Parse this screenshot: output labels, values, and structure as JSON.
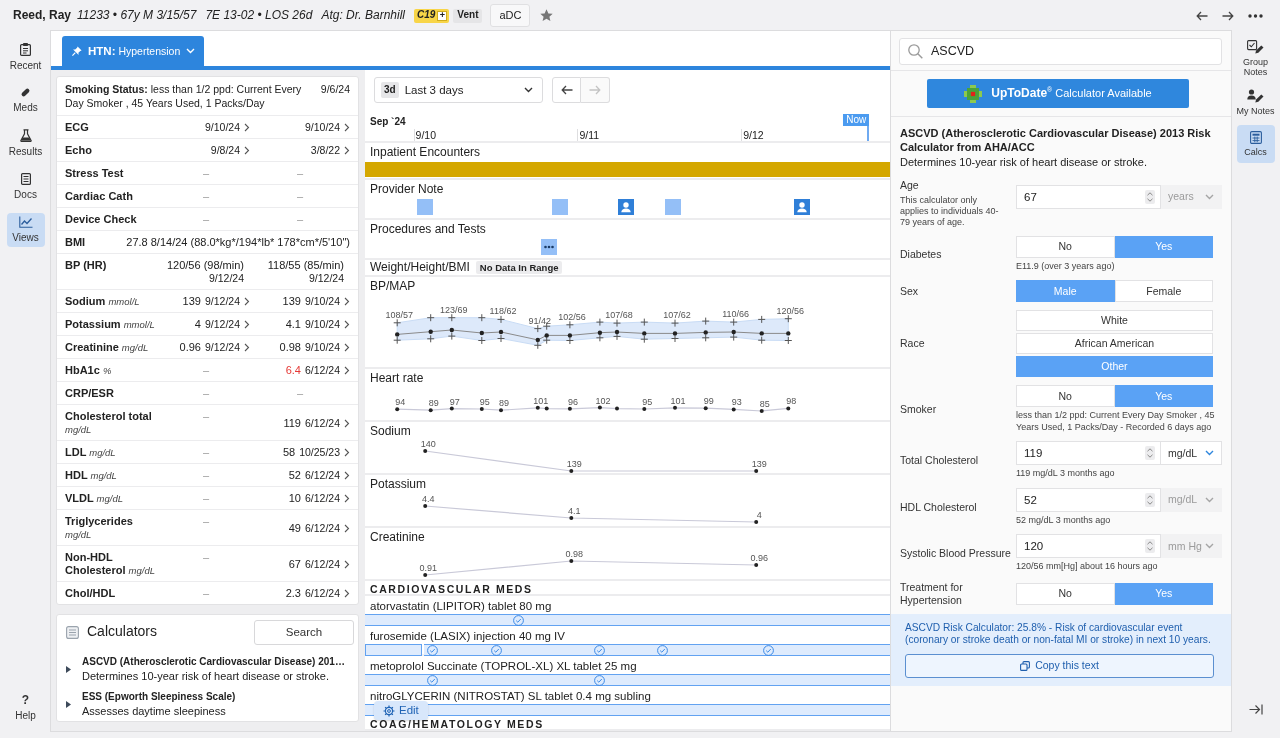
{
  "patient": {
    "name": "Reed, Ray",
    "details": [
      "11233 • 67y M 3/15/57",
      "7E 13-02 • LOS 26d",
      "Atg: Dr. Barnhill"
    ],
    "badges": [
      {
        "kind": "alert",
        "label": "C19",
        "extra": "+"
      },
      {
        "kind": "plain",
        "label": "Vent"
      }
    ],
    "button": "aDC"
  },
  "left_nav": {
    "items": [
      {
        "label": "Recent",
        "selected": false
      },
      {
        "label": "Meds",
        "selected": false
      },
      {
        "label": "Results",
        "selected": false
      },
      {
        "label": "Docs",
        "selected": false
      },
      {
        "label": "Views",
        "selected": true
      }
    ],
    "help": {
      "symbol": "?",
      "label": "Help"
    }
  },
  "problem_tab": {
    "label": "**HTN:** Hypertension",
    "selected": true
  },
  "summary_table": {
    "rows": [
      {
        "kind": "note",
        "text": "**Smoking Status:** less than 1/2 ppd: Current Every Day Smoker , 45 Years Used, 1 Packs/Day",
        "date": "9/6/24"
      },
      {
        "kind": "lab",
        "name": "ECG",
        "cells": [
          {
            "date": "9/10/24"
          },
          {
            "date": "9/10/24"
          }
        ]
      },
      {
        "kind": "lab",
        "name": "Echo",
        "cells": [
          {
            "date": "9/8/24"
          },
          {
            "date": "3/8/22"
          }
        ]
      },
      {
        "kind": "lab",
        "name": "Stress Test",
        "cells": [
          {
            "value": "–"
          },
          {
            "value": "–"
          }
        ]
      },
      {
        "kind": "lab",
        "name": "Cardiac Cath",
        "cells": [
          {
            "value": "–"
          },
          {
            "value": "–"
          }
        ]
      },
      {
        "kind": "lab",
        "name": "Device Check",
        "cells": [
          {
            "value": "–"
          },
          {
            "value": "–"
          }
        ]
      },
      {
        "kind": "wide",
        "name": "BMI",
        "text": "27.8 8/14/24 (88.0*kg*/194*lb* 178*cm*/5'10\")"
      },
      {
        "kind": "stacked",
        "name": "BP (HR)",
        "cells": [
          {
            "value": "120/56 (98/min)",
            "date": "9/12/24"
          },
          {
            "value": "118/55 (85/min)",
            "date": "9/12/24"
          }
        ]
      },
      {
        "kind": "lab",
        "name": "Sodium",
        "unit": "mmol/L",
        "cells": [
          {
            "value": "139",
            "date": "9/12/24",
            "abnormal": false
          },
          {
            "value": "139",
            "date": "9/10/24",
            "abnormal": false
          }
        ]
      },
      {
        "kind": "lab",
        "name": "Potassium",
        "unit": "mmol/L",
        "cells": [
          {
            "value": "4",
            "date": "9/12/24",
            "abnormal": false
          },
          {
            "value": "4.1",
            "date": "9/10/24",
            "abnormal": false
          }
        ]
      },
      {
        "kind": "lab",
        "name": "Creatinine",
        "unit": "mg/dL",
        "cells": [
          {
            "value": "0.96",
            "date": "9/12/24",
            "abnormal": false
          },
          {
            "value": "0.98",
            "date": "9/10/24",
            "abnormal": false
          }
        ]
      },
      {
        "kind": "lab",
        "name": "HbA1c",
        "unit": "%",
        "cells": [
          {
            "value": "–"
          },
          {
            "value": "6.4",
            "date": "6/12/24",
            "abnormal": true
          }
        ]
      },
      {
        "kind": "lab",
        "name": "CRP/ESR",
        "cells": [
          {
            "value": "–"
          },
          {
            "value": "–"
          }
        ]
      },
      {
        "kind": "lab",
        "name": "Cholesterol total",
        "unit": "mg/dL",
        "cells": [
          {
            "value": "–"
          },
          {
            "value": "119",
            "date": "6/12/24",
            "abnormal": false
          }
        ]
      },
      {
        "kind": "lab",
        "name": "LDL",
        "unit": "mg/dL",
        "cells": [
          {
            "value": "–"
          },
          {
            "value": "58",
            "date": "10/25/23",
            "abnormal": false
          }
        ]
      },
      {
        "kind": "lab",
        "name": "HDL",
        "unit": "mg/dL",
        "cells": [
          {
            "value": "–"
          },
          {
            "value": "52",
            "date": "6/12/24",
            "abnormal": false
          }
        ]
      },
      {
        "kind": "lab",
        "name": "VLDL",
        "unit": "mg/dL",
        "cells": [
          {
            "value": "–"
          },
          {
            "value": "10",
            "date": "6/12/24",
            "abnormal": false
          }
        ]
      },
      {
        "kind": "lab",
        "name": "Triglycerides",
        "unit": "mg/dL",
        "cells": [
          {
            "value": "–"
          },
          {
            "value": "49",
            "date": "6/12/24",
            "abnormal": false
          }
        ]
      },
      {
        "kind": "lab",
        "name": "Non-HDL Cholesterol",
        "unit": "mg/dL",
        "cells": [
          {
            "value": "–"
          },
          {
            "value": "67",
            "date": "6/12/24",
            "abnormal": false
          }
        ]
      },
      {
        "kind": "lab",
        "name": "Chol/HDL",
        "cells": [
          {
            "value": "–"
          },
          {
            "value": "2.3",
            "date": "6/12/24",
            "abnormal": false
          }
        ]
      }
    ]
  },
  "calculators": {
    "title": "Calculators",
    "search_button": "Search",
    "items": [
      {
        "title": "ASCVD (Atherosclerotic Cardiovascular Disease) 201…",
        "description": "Determines 10-year risk of heart disease or stroke.",
        "expanded": false
      },
      {
        "title": "ESS (Epworth Sleepiness Scale)",
        "description": "Assesses daytime sleepiness",
        "expanded": false
      }
    ]
  },
  "timeline": {
    "range": {
      "badge": "3d",
      "label": "Last 3 days"
    },
    "nav_buttons": [
      {
        "kind": "prev",
        "disabled": false
      },
      {
        "kind": "next",
        "disabled": true
      }
    ],
    "month": "Sep `24",
    "dates": [
      "9/10",
      "9/11",
      "9/12"
    ],
    "now": "Now",
    "sections": [
      {
        "kind": "band",
        "label": "Inpatient Encounters"
      },
      {
        "kind": "markers",
        "label": "Provider Note",
        "markers": [
          {
            "kind": "note"
          },
          {
            "kind": "note"
          },
          {
            "kind": "author"
          },
          {
            "kind": "note"
          },
          {
            "kind": "author"
          }
        ]
      },
      {
        "kind": "markers",
        "label": "Procedures and Tests",
        "markers": [
          {
            "kind": "group"
          }
        ]
      },
      {
        "kind": "empty",
        "label": "Weight/Height/BMI",
        "badge": "No Data In Range"
      },
      {
        "kind": "bp",
        "label": "BP/MAP",
        "points": [
          {
            "kind": "range",
            "label": "108/57"
          },
          {
            "kind": "range"
          },
          {
            "kind": "range",
            "label": "123/69"
          },
          {
            "kind": "range"
          },
          {
            "kind": "range",
            "label": "118/62"
          },
          {
            "kind": "range",
            "label": "91/42"
          },
          {
            "kind": "range"
          },
          {
            "kind": "range",
            "label": "102/56"
          },
          {
            "kind": "range"
          },
          {
            "kind": "range",
            "label": "107/68"
          },
          {
            "kind": "range"
          },
          {
            "kind": "range",
            "label": "107/62"
          },
          {
            "kind": "range"
          },
          {
            "kind": "range",
            "label": "110/66"
          },
          {
            "kind": "range"
          },
          {
            "kind": "range",
            "label": "120/56"
          }
        ]
      },
      {
        "kind": "trend",
        "label": "Heart rate",
        "points": [
          {
            "kind": "dot",
            "label": "94"
          },
          {
            "kind": "dot",
            "label": "89"
          },
          {
            "kind": "dot",
            "label": "97"
          },
          {
            "kind": "dot",
            "label": "95"
          },
          {
            "kind": "dot",
            "label": "89"
          },
          {
            "kind": "dot",
            "label": "101"
          },
          {
            "kind": "dot"
          },
          {
            "kind": "dot",
            "label": "96"
          },
          {
            "kind": "dot",
            "label": "102"
          },
          {
            "kind": "dot"
          },
          {
            "kind": "dot",
            "label": "95"
          },
          {
            "kind": "dot",
            "label": "101"
          },
          {
            "kind": "dot",
            "label": "99"
          },
          {
            "kind": "dot",
            "label": "93"
          },
          {
            "kind": "dot",
            "label": "85"
          },
          {
            "kind": "dot",
            "label": "98"
          }
        ]
      },
      {
        "kind": "trend",
        "label": "Sodium",
        "points": [
          {
            "kind": "dot",
            "label": "140"
          },
          {
            "kind": "dot",
            "label": "139"
          },
          {
            "kind": "dot",
            "label": "139"
          }
        ]
      },
      {
        "kind": "trend",
        "label": "Potassium",
        "points": [
          {
            "kind": "dot",
            "label": "4.4"
          },
          {
            "kind": "dot",
            "label": "4.1"
          },
          {
            "kind": "dot",
            "label": "4"
          }
        ]
      },
      {
        "kind": "trend",
        "label": "Creatinine",
        "points": [
          {
            "kind": "dot",
            "label": "0.91"
          },
          {
            "kind": "dot",
            "label": "0.98"
          },
          {
            "kind": "dot",
            "label": "0.96"
          }
        ]
      }
    ],
    "med_groups": [
      {
        "title": "CARDIOVASCULAR MEDS",
        "meds": [
          {
            "name": "atorvastatin (LIPITOR) tablet 80 mg",
            "orders": [
              {
                "kind": "active"
              }
            ],
            "doses": [
              {
                "kind": "given"
              }
            ]
          },
          {
            "name": "furosemide (LASIX) injection 40 mg IV",
            "orders": [
              {
                "kind": "active"
              },
              {
                "kind": "active"
              }
            ],
            "doses": [
              {
                "kind": "given"
              },
              {
                "kind": "given"
              },
              {
                "kind": "given"
              },
              {
                "kind": "given"
              },
              {
                "kind": "given"
              }
            ]
          },
          {
            "name": "metoprolol Succinate (TOPROL-XL) XL tablet 25 mg",
            "orders": [
              {
                "kind": "active"
              }
            ],
            "doses": [
              {
                "kind": "given"
              },
              {
                "kind": "given"
              }
            ]
          },
          {
            "name": "nitroGLYCERIN (NITROSTAT) SL tablet 0.4 mg subling",
            "orders": [
              {
                "kind": "active"
              }
            ]
          }
        ]
      },
      {
        "title": "COAG/HEMATOLOGY MEDS"
      }
    ],
    "edit_button": "Edit"
  },
  "calculator": {
    "search": {
      "value": "ASCVD"
    },
    "uptodate_button": "**UpToDate**$^{®}$ Calculator Available",
    "title": "ASCVD (Atherosclerotic Cardiovascular Disease) 2013 Risk Calculator from AHA/ACC",
    "description": "Determines 10-year risk of heart disease or stroke.",
    "fields": [
      {
        "kind": "number",
        "label": "Age",
        "hint": "This calculator only applies to individuals 40-79 years of age.",
        "value": "67",
        "unit": {
          "label": "years",
          "disabled": true
        }
      },
      {
        "kind": "toggle",
        "label": "Diabetes",
        "options": [
          {
            "label": "No",
            "selected": false
          },
          {
            "label": "Yes",
            "selected": true
          }
        ],
        "note": "E11.9 (over 3 years ago)"
      },
      {
        "kind": "toggle",
        "label": "Sex",
        "options": [
          {
            "label": "Male",
            "selected": true
          },
          {
            "label": "Female",
            "selected": false
          }
        ]
      },
      {
        "kind": "stack",
        "label": "Race",
        "options": [
          {
            "label": "White",
            "selected": false
          },
          {
            "label": "African American",
            "selected": false
          },
          {
            "label": "Other",
            "selected": true
          }
        ]
      },
      {
        "kind": "toggle",
        "label": "Smoker",
        "options": [
          {
            "label": "No",
            "selected": false
          },
          {
            "label": "Yes",
            "selected": true
          }
        ],
        "note": "less than 1/2 ppd: Current Every Day Smoker , 45 Years Used, 1 Packs/Day - Recorded 6 days ago"
      },
      {
        "kind": "number",
        "label": "Total Cholesterol",
        "value": "119",
        "unit": {
          "label": "mg/dL",
          "disabled": false
        },
        "note": "119 mg/dL 3 months ago"
      },
      {
        "kind": "number",
        "label": "HDL Cholesterol",
        "value": "52",
        "unit": {
          "label": "mg/dL",
          "disabled": true
        },
        "note": "52 mg/dL 3 months ago"
      },
      {
        "kind": "number",
        "label": "Systolic Blood Pressure",
        "value": "120",
        "unit": {
          "label": "mm Hg",
          "disabled": true
        },
        "note": "120/56 mm[Hg] about 16 hours ago"
      },
      {
        "kind": "toggle",
        "label": "Treatment for Hypertension",
        "options": [
          {
            "label": "No",
            "selected": false
          },
          {
            "label": "Yes",
            "selected": true
          }
        ]
      }
    ],
    "result": "ASCVD Risk Calculator: 25.8% - Risk of cardiovascular event (coronary or stroke death or non-fatal MI or stroke) in next 10 years.",
    "copy_button": "Copy this text"
  },
  "right_nav": {
    "items": [
      {
        "label": "Group Notes",
        "selected": false
      },
      {
        "label": "My Notes",
        "selected": false
      },
      {
        "label": "Calcs",
        "selected": true
      }
    ]
  }
}
